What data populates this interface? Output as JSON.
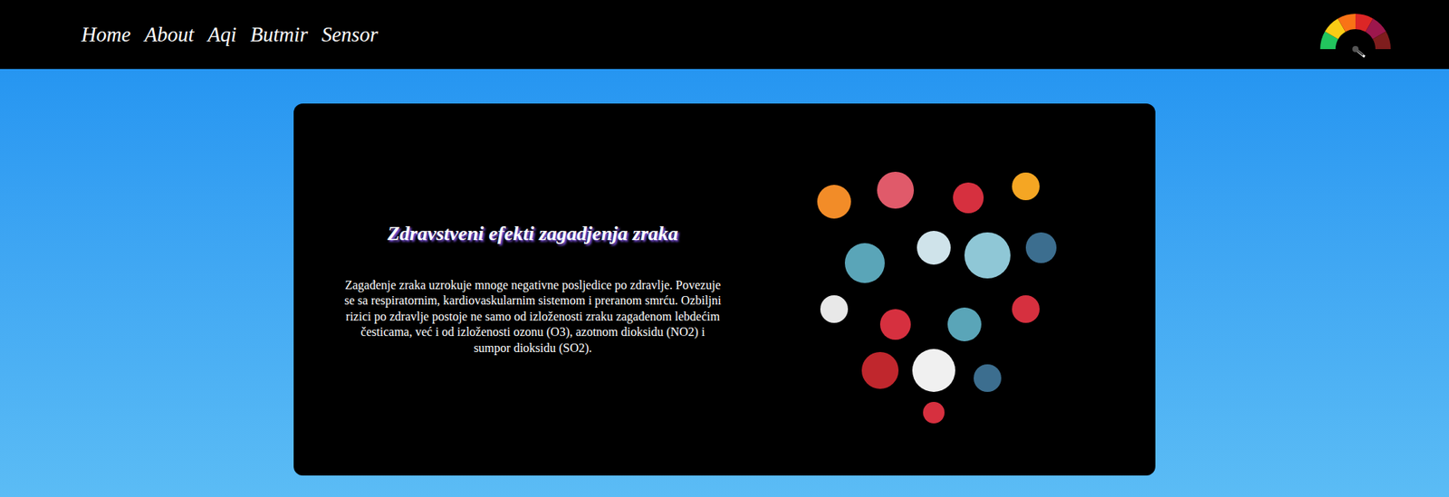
{
  "nav": {
    "items": [
      {
        "label": "Home"
      },
      {
        "label": "About"
      },
      {
        "label": "Aqi"
      },
      {
        "label": "Butmir"
      },
      {
        "label": "Sensor"
      }
    ]
  },
  "card": {
    "title": "Zdravstveni efekti zagadjenja zraka",
    "text": "Zagađenje zraka uzrokuje mnoge negativne posljedice po zdravlje. Povezuje se sa respiratornim, kardiovaskularnim sistemom i preranom smrću. Ozbiljni rizici po zdravlje postoje ne samo od izloženosti zraku zagađenom lebdećim česticama, već i od izloženosti ozonu (O3), azotnom dioksidu (NO2) i sumpor dioksidu (SO2)."
  }
}
